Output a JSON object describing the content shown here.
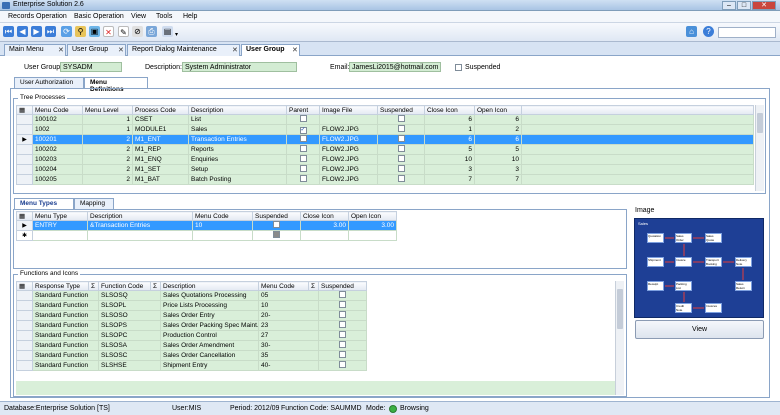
{
  "app": {
    "title": "Enterprise Solution  2.6"
  },
  "menu": [
    "Records Operation",
    "Basic Operation",
    "View",
    "Tools",
    "Help"
  ],
  "doc_tabs": [
    {
      "label": "Main Menu"
    },
    {
      "label": "User Group"
    },
    {
      "label": "Report Dialog Maintenance"
    },
    {
      "label": "User Group"
    }
  ],
  "header": {
    "user_group_label": "User Group:",
    "user_group_value": "SYSADM",
    "description_label": "Description:",
    "description_value": "System Administrator",
    "email_label": "Email:",
    "email_value": "JamesLi2015@hotmail.com",
    "suspended_label": "Suspended"
  },
  "page_tabs": [
    "User Authorization",
    "Menu Definitions"
  ],
  "tree": {
    "title": "Tree Processes",
    "columns": [
      "Menu Code",
      "Menu Level",
      "Process Code",
      "Description",
      "Parent",
      "Image File",
      "Suspended",
      "Close Icon",
      "Open Icon"
    ],
    "rows": [
      [
        "100102",
        "1",
        "CSET",
        "List",
        "",
        "",
        "",
        "6",
        "6"
      ],
      [
        "1002",
        "1",
        "MODULE1",
        "Sales",
        "checked",
        "FLOW2.JPG",
        "",
        "1",
        "2"
      ],
      [
        "100201",
        "2",
        "M1_ENT",
        "Transaction Entries",
        "",
        "FLOW2.JPG",
        "",
        "6",
        "6"
      ],
      [
        "100202",
        "2",
        "M1_REP",
        "Reports",
        "",
        "FLOW2.JPG",
        "",
        "5",
        "5"
      ],
      [
        "100203",
        "2",
        "M1_ENQ",
        "Enquiries",
        "",
        "FLOW2.JPG",
        "",
        "10",
        "10"
      ],
      [
        "100204",
        "2",
        "M1_SET",
        "Setup",
        "",
        "FLOW2.JPG",
        "",
        "3",
        "3"
      ],
      [
        "100205",
        "2",
        "M1_BAT",
        "Batch Posting",
        "",
        "FLOW2.JPG",
        "",
        "7",
        "7"
      ]
    ]
  },
  "sub_tabs": [
    "Menu Types",
    "Mapping"
  ],
  "menu_types": {
    "columns": [
      "Menu Type",
      "Description",
      "Menu Code",
      "Suspended",
      "Close Icon",
      "Open Icon"
    ],
    "rows": [
      [
        "ENTRY",
        "&Transaction Entries",
        "10",
        "",
        "3.00",
        "3.00"
      ]
    ]
  },
  "functions": {
    "title": "Functions and Icons",
    "columns": [
      "Response Type",
      "Function Code",
      "Description",
      "Menu Code",
      "Suspended"
    ],
    "rows": [
      [
        "Standard Function",
        "SLSOSQ",
        "Sales Quotations Processing",
        "05"
      ],
      [
        "Standard Function",
        "SLSOPL",
        "Price Lists Processing",
        "10"
      ],
      [
        "Standard Function",
        "SLSOSO",
        "Sales Order Entry",
        "20-"
      ],
      [
        "Standard Function",
        "SLSOPS",
        "Sales Order Packing Spec Maint...",
        "23"
      ],
      [
        "Standard Function",
        "SLSOPC",
        "Production Control",
        "27"
      ],
      [
        "Standard Function",
        "SLSOSA",
        "Sales Order Amendment",
        "30-"
      ],
      [
        "Standard Function",
        "SLSOSC",
        "Sales Order Cancellation",
        "35"
      ],
      [
        "Standard Function",
        "SLSHSE",
        "Shipment Entry",
        "40-"
      ]
    ]
  },
  "image_panel": {
    "title": "Image",
    "diagram_title": "Sales",
    "boxes": [
      "Quotation",
      "Sales Order",
      "Sales Quote",
      "Shipment",
      "Invoice",
      "Transport Booking",
      "Delivery Note",
      "Receipt",
      "Packing List",
      "Sales Return",
      "Credit Note",
      "Invoices"
    ],
    "view_label": "View"
  },
  "status": {
    "database": "Database:Enterprise Solution [TS]",
    "user": "User:MIS",
    "period": "Period:  2012/09",
    "function_code": "Function Code:  SAUMMD",
    "mode": "Mode:",
    "mode_value": "Browsing"
  }
}
